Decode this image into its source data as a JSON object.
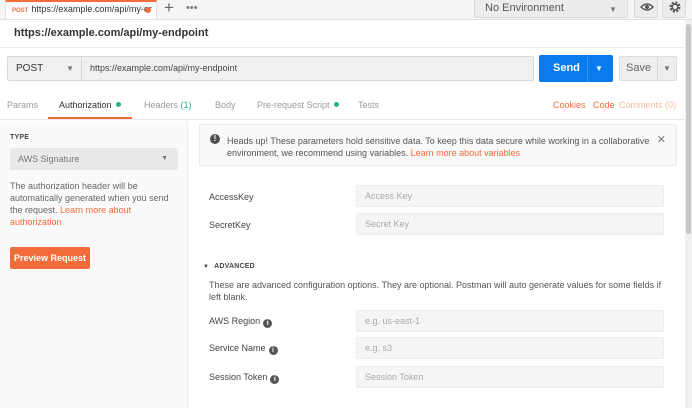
{
  "tab": {
    "method": "POST",
    "title": "https://example.com/api/my-er",
    "add": "+",
    "more": "•••"
  },
  "environment": {
    "selected": "No Environment"
  },
  "request": {
    "title": "https://example.com/api/my-endpoint",
    "method": "POST",
    "url": "https://example.com/api/my-endpoint",
    "send_label": "Send",
    "save_label": "Save"
  },
  "request_tabs": {
    "params": "Params",
    "authorization": "Authorization",
    "headers": "Headers",
    "headers_count": "(1)",
    "body": "Body",
    "prerequest": "Pre-request Script",
    "tests": "Tests",
    "cookies": "Cookies",
    "code": "Code",
    "comments": "Comments (0)"
  },
  "auth": {
    "type_heading": "TYPE",
    "type_value": "AWS Signature",
    "description": "The authorization header will be automatically generated when you send the request.",
    "learn_more": "Learn more about authorization",
    "preview_button": "Preview Request"
  },
  "alert": {
    "text": "Heads up! These parameters hold sensitive data. To keep this data secure while working in a collaborative environment, we recommend using variables.",
    "link": "Learn more about variables",
    "close": "✕"
  },
  "fields": {
    "access_key": {
      "label": "AccessKey",
      "placeholder": "Access Key"
    },
    "secret_key": {
      "label": "SecretKey",
      "placeholder": "Secret Key"
    }
  },
  "advanced": {
    "heading": "ADVANCED",
    "description": "These are advanced configuration options. They are optional. Postman will auto generate values for some fields if left blank.",
    "aws_region": {
      "label": "AWS Region",
      "placeholder": "e.g. us-east-1"
    },
    "service_name": {
      "label": "Service Name",
      "placeholder": "e.g. s3"
    },
    "session_token": {
      "label": "Session Token",
      "placeholder": "Session Token"
    }
  },
  "colors": {
    "accent": "#f26b3a",
    "primary": "#097bed",
    "success": "#26b47f"
  },
  "icons": {
    "eye": "eye-icon",
    "settings": "gear-icon",
    "info": "info-icon"
  }
}
